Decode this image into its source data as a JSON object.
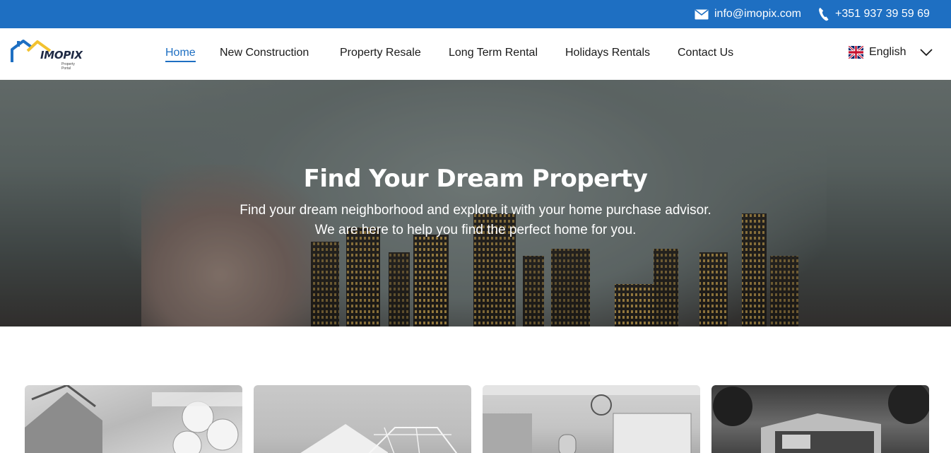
{
  "topbar": {
    "email": "info@imopix.com",
    "phone": "+351 937 39 59 69",
    "email_icon": "envelope-icon",
    "phone_icon": "phone-icon",
    "background": "#1e6fc2"
  },
  "logo": {
    "name": "IMOPIX",
    "tagline": "Property Portal"
  },
  "nav": {
    "items": [
      {
        "label": "Home",
        "active": true
      },
      {
        "label": "New Construction",
        "active": false
      },
      {
        "label": "Property Resale",
        "active": false
      },
      {
        "label": "Long Term Rental",
        "active": false
      },
      {
        "label": "Holidays Rentals",
        "active": false
      },
      {
        "label": "Contact Us",
        "active": false
      }
    ],
    "accent": "#1e6fc2"
  },
  "language": {
    "selected": "English",
    "flag_icon": "uk-flag-icon",
    "chevron_icon": "chevron-down-icon"
  },
  "hero": {
    "title": "Find Your Dream Property",
    "subtitle": "Find your dream neighborhood and explore it with your home purchase advisor. We are here to help you find the perfect home for you."
  },
  "cards": [
    {
      "image": "blueprints-house-model"
    },
    {
      "image": "house-construction"
    },
    {
      "image": "interior-room"
    },
    {
      "image": "modern-house-forest"
    }
  ]
}
